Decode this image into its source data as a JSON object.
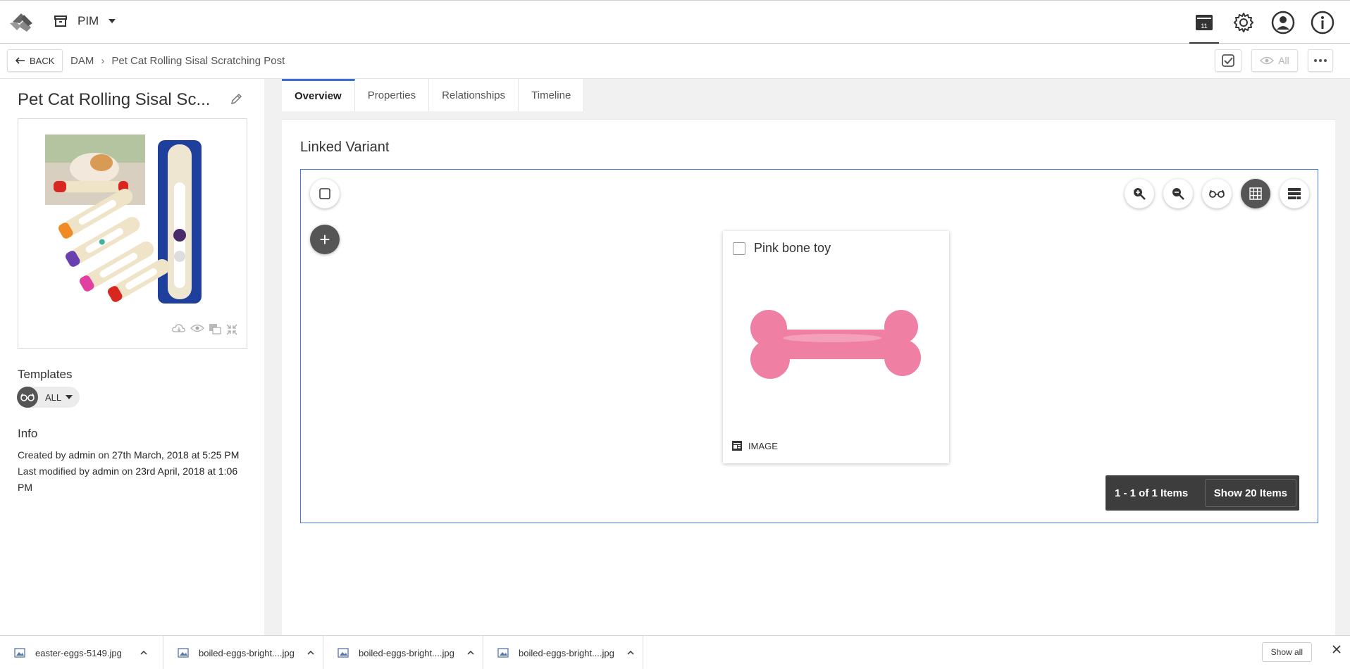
{
  "topbar": {
    "app_name": "PIM",
    "icons": [
      "logo-icon",
      "archive-icon",
      "caret-down-icon",
      "notifications-box-icon",
      "gear-icon",
      "user-account-icon",
      "info-icon"
    ],
    "notification_count": "11"
  },
  "breadcrumb_bar": {
    "back_label": "BACK",
    "crumbs": [
      "DAM",
      "Pet Cat Rolling Sisal Scratching Post"
    ],
    "separator": "›",
    "view_label": "All"
  },
  "entity": {
    "title": "Pet Cat Rolling Sisal Sc...",
    "templates_label": "Templates",
    "template_value": "ALL",
    "info_label": "Info",
    "created_prefix": "Created by",
    "created_user": "admin",
    "created_on": "on",
    "created_date": "27th March, 2018 at 5:25 PM",
    "modified_prefix": "Last modified by",
    "modified_user": "admin",
    "modified_on": "on",
    "modified_date": "23rd April, 2018 at 1:06 PM"
  },
  "tabs": [
    {
      "label": "Overview",
      "active": true
    },
    {
      "label": "Properties",
      "active": false
    },
    {
      "label": "Relationships",
      "active": false
    },
    {
      "label": "Timeline",
      "active": false
    }
  ],
  "linked_variant": {
    "title": "Linked Variant",
    "add_label": "+",
    "card": {
      "title": "Pink bone toy",
      "type_label": "IMAGE"
    },
    "pager": {
      "range": "1 - 1 of 1 Items",
      "show": "Show 20 Items"
    }
  },
  "downloads": {
    "files": [
      "easter-eggs-5149.jpg",
      "boiled-eggs-bright....jpg",
      "boiled-eggs-bright....jpg",
      "boiled-eggs-bright....jpg"
    ],
    "show_all": "Show all"
  },
  "colors": {
    "accent": "#3b6fd4",
    "dark_button": "#555555",
    "pager_bg": "#3d3d3d",
    "bone_pink": "#ef7fa3"
  }
}
